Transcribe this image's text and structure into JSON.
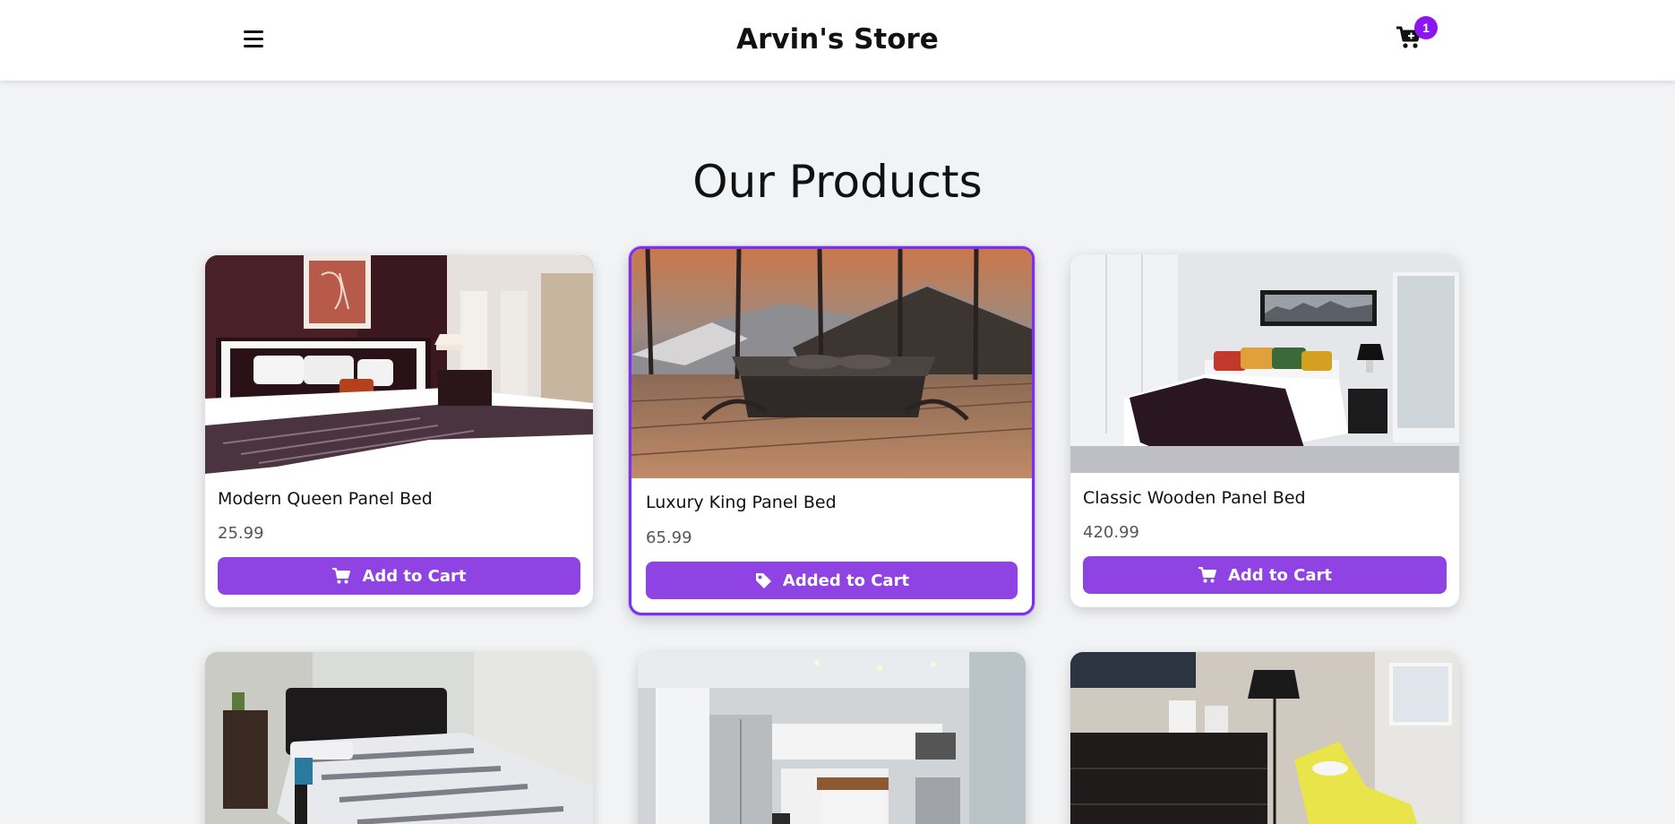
{
  "header": {
    "store_name": "Arvin's Store",
    "cart_count": "1"
  },
  "main": {
    "title": "Our Products"
  },
  "products": [
    {
      "name": "Modern Queen Panel Bed",
      "price": "25.99",
      "button_label": "Add to Cart",
      "button_icon": "cart-icon"
    },
    {
      "name": "Luxury King Panel Bed",
      "price": "65.99",
      "button_label": "Added to Cart",
      "button_icon": "tag-icon"
    },
    {
      "name": "Classic Wooden Panel Bed",
      "price": "420.99",
      "button_label": "Add to Cart",
      "button_icon": "cart-icon"
    }
  ],
  "colors": {
    "accent": "#8e43e2",
    "badge": "#8a16f0",
    "selected_border": "#7b2ff0",
    "background": "#f2f3f5"
  }
}
